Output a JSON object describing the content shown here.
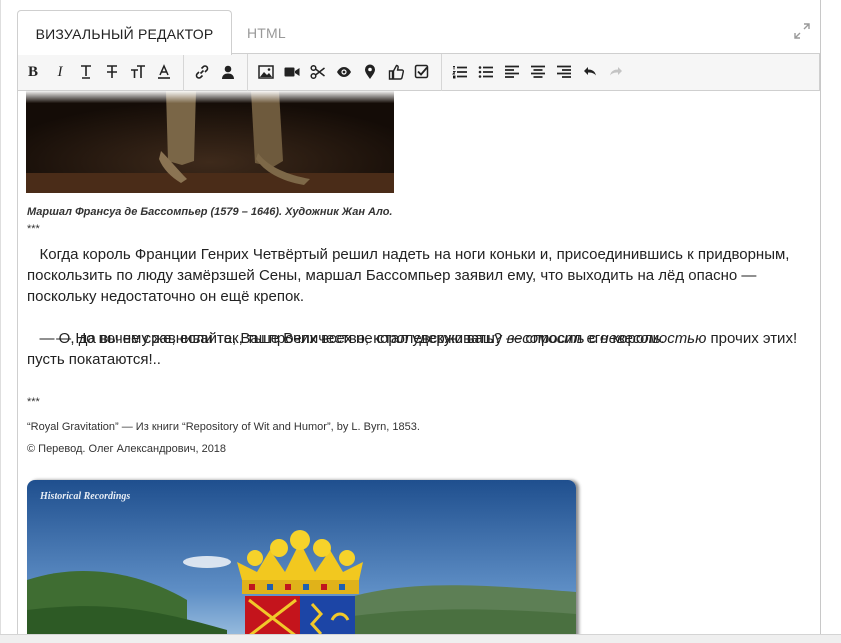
{
  "tabs": {
    "visual": "ВИЗУАЛЬНЫЙ РЕДАКТОР",
    "html": "HTML"
  },
  "toolbar": {
    "icons": [
      "bold-icon",
      "italic-icon",
      "underline-icon",
      "strikethrough-icon",
      "font-size-icon",
      "font-color-icon",
      "link-icon",
      "user-icon",
      "image-icon",
      "video-icon",
      "cut-icon",
      "eye-icon",
      "location-pin-icon",
      "like-icon",
      "checkbox-icon",
      "ordered-list-icon",
      "unordered-list-icon",
      "align-left-icon",
      "align-center-icon",
      "align-right-icon",
      "undo-icon",
      "redo-icon"
    ],
    "bold": "B",
    "italic": "I"
  },
  "content": {
    "caption": "Маршал Франсуа де Бассомпьер (1579 – 1646). Художник Жан Ало.",
    "stars_top": "***",
    "paragraph1": "   Когда король Франции Генрих Четвёртый решил надеть на ноги коньки и, присоединившись к придворным, поскользить по люду замёрзшей Сены, маршал Бассомпьер заявил ему, что выходить на лёд опасно — поскольку недостаточно он ещё крепок.",
    "paragraph2": "   — Но почему же, если так, ты прочих всех не стал удерживать? — спросил его король.",
    "paragraph3_before": "   — О, да вы не сравнивайте, Ваше Величество, королевскую вашу ",
    "paragraph3_em1": "весомость",
    "paragraph3_mid": " с ",
    "paragraph3_em2": "невесомостью",
    "paragraph3_after": " прочих этих! пусть покатаются!..",
    "stars_bottom": "***",
    "source": "“Royal Gravitation” — Из книги “Repository of Wit and Humor”, by L. Byrn, 1853.",
    "copyright": "© Перевод. Олег Александрович, 2018",
    "video_label": "Historical Recordings"
  },
  "colors": {
    "accent_disabled": "#999999",
    "toolbar_bg": "#f6f6f6",
    "border": "#cfcfcf"
  }
}
